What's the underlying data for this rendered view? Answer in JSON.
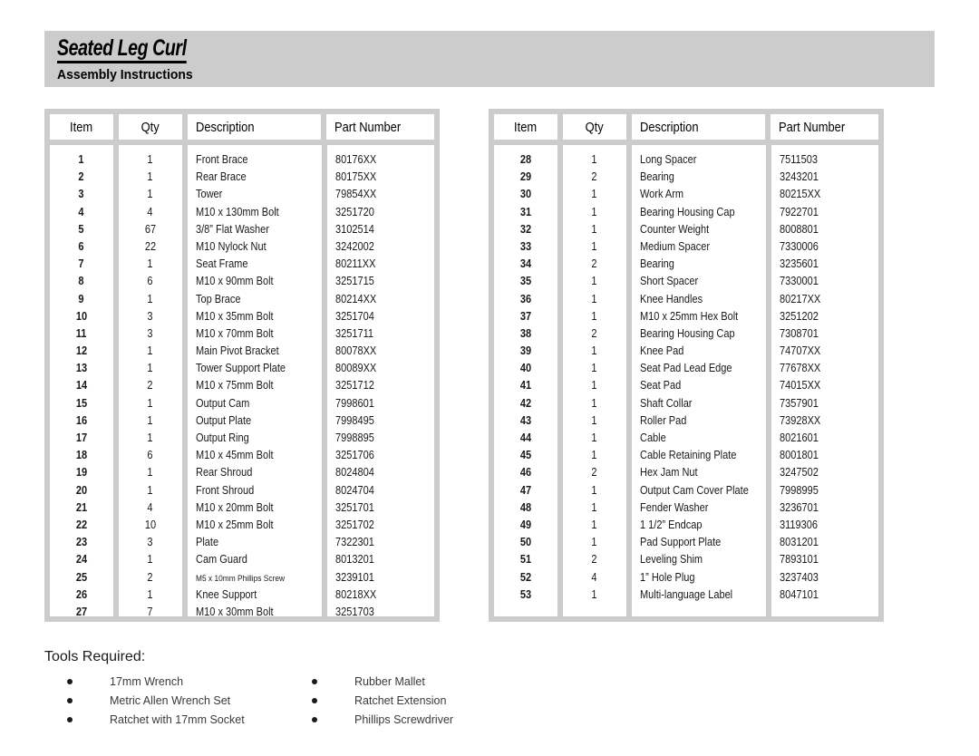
{
  "header": {
    "title": "Seated Leg Curl",
    "subtitle": "Assembly Instructions",
    "background_color": "#cccccc"
  },
  "tables": {
    "columns": [
      "Item",
      "Qty",
      "Description",
      "Part Number"
    ],
    "left": {
      "headers": [
        "Item",
        "Qty",
        "Description",
        "Part Number"
      ],
      "rows": [
        {
          "item": "1",
          "qty": "1",
          "description": "Front Brace",
          "part": "80176XX"
        },
        {
          "item": "2",
          "qty": "1",
          "description": "Rear Brace",
          "part": "80175XX"
        },
        {
          "item": "3",
          "qty": "1",
          "description": "Tower",
          "part": "79854XX"
        },
        {
          "item": "4",
          "qty": "4",
          "description": "M10 x 130mm Bolt",
          "part": "3251720"
        },
        {
          "item": "5",
          "qty": "67",
          "description": "3/8” Flat Washer",
          "part": "3102514"
        },
        {
          "item": "6",
          "qty": "22",
          "description": "M10 Nylock Nut",
          "part": "3242002"
        },
        {
          "item": "7",
          "qty": "1",
          "description": "Seat Frame",
          "part": "80211XX"
        },
        {
          "item": "8",
          "qty": "6",
          "description": "M10 x 90mm Bolt",
          "part": "3251715"
        },
        {
          "item": "9",
          "qty": "1",
          "description": "Top Brace",
          "part": "80214XX"
        },
        {
          "item": "10",
          "qty": "3",
          "description": "M10 x 35mm Bolt",
          "part": "3251704"
        },
        {
          "item": "11",
          "qty": "3",
          "description": "M10 x 70mm Bolt",
          "part": "3251711"
        },
        {
          "item": "12",
          "qty": "1",
          "description": "Main Pivot Bracket",
          "part": "80078XX"
        },
        {
          "item": "13",
          "qty": "1",
          "description": "Tower Support Plate",
          "part": "80089XX"
        },
        {
          "item": "14",
          "qty": "2",
          "description": "M10 x 75mm Bolt",
          "part": "3251712"
        },
        {
          "item": "15",
          "qty": "1",
          "description": "Output Cam",
          "part": "7998601"
        },
        {
          "item": "16",
          "qty": "1",
          "description": "Output Plate",
          "part": "7998495"
        },
        {
          "item": "17",
          "qty": "1",
          "description": "Output Ring",
          "part": "7998895"
        },
        {
          "item": "18",
          "qty": "6",
          "description": "M10 x 45mm Bolt",
          "part": "3251706"
        },
        {
          "item": "19",
          "qty": "1",
          "description": "Rear Shroud",
          "part": "8024804"
        },
        {
          "item": "20",
          "qty": "1",
          "description": "Front Shroud",
          "part": "8024704"
        },
        {
          "item": "21",
          "qty": "4",
          "description": "M10 x 20mm Bolt",
          "part": "3251701"
        },
        {
          "item": "22",
          "qty": "10",
          "description": "M10 x 25mm Bolt",
          "part": "3251702"
        },
        {
          "item": "23",
          "qty": "3",
          "description": "Plate",
          "part": "7322301"
        },
        {
          "item": "24",
          "qty": "1",
          "description": "Cam Guard",
          "part": "8013201"
        },
        {
          "item": "25",
          "qty": "2",
          "description": "M5 x 10mm Phillips Screw",
          "part": "3239101",
          "small": true
        },
        {
          "item": "26",
          "qty": "1",
          "description": "Knee Support",
          "part": "80218XX"
        },
        {
          "item": "27",
          "qty": "7",
          "description": "M10 x 30mm Bolt",
          "part": "3251703"
        }
      ]
    },
    "right": {
      "headers": [
        "Item",
        "Qty",
        "Description",
        "Part Number"
      ],
      "rows": [
        {
          "item": "28",
          "qty": "1",
          "description": "Long Spacer",
          "part": "7511503"
        },
        {
          "item": "29",
          "qty": "2",
          "description": "Bearing",
          "part": "3243201"
        },
        {
          "item": "30",
          "qty": "1",
          "description": "Work Arm",
          "part": "80215XX"
        },
        {
          "item": "31",
          "qty": "1",
          "description": "Bearing Housing Cap",
          "part": "7922701"
        },
        {
          "item": "32",
          "qty": "1",
          "description": "Counter Weight",
          "part": "8008801"
        },
        {
          "item": "33",
          "qty": "1",
          "description": "Medium Spacer",
          "part": "7330006"
        },
        {
          "item": "34",
          "qty": "2",
          "description": "Bearing",
          "part": "3235601"
        },
        {
          "item": "35",
          "qty": "1",
          "description": "Short Spacer",
          "part": "7330001"
        },
        {
          "item": "36",
          "qty": "1",
          "description": "Knee Handles",
          "part": "80217XX"
        },
        {
          "item": "37",
          "qty": "1",
          "description": "M10 x 25mm Hex Bolt",
          "part": "3251202"
        },
        {
          "item": "38",
          "qty": "2",
          "description": "Bearing Housing Cap",
          "part": "7308701"
        },
        {
          "item": "39",
          "qty": "1",
          "description": "Knee Pad",
          "part": "74707XX"
        },
        {
          "item": "40",
          "qty": "1",
          "description": "Seat Pad Lead Edge",
          "part": "77678XX"
        },
        {
          "item": "41",
          "qty": "1",
          "description": "Seat Pad",
          "part": "74015XX"
        },
        {
          "item": "42",
          "qty": "1",
          "description": "Shaft Collar",
          "part": "7357901"
        },
        {
          "item": "43",
          "qty": "1",
          "description": "Roller Pad",
          "part": "73928XX"
        },
        {
          "item": "44",
          "qty": "1",
          "description": "Cable",
          "part": "8021601"
        },
        {
          "item": "45",
          "qty": "1",
          "description": "Cable Retaining Plate",
          "part": "8001801"
        },
        {
          "item": "46",
          "qty": "2",
          "description": "Hex Jam Nut",
          "part": "3247502"
        },
        {
          "item": "47",
          "qty": "1",
          "description": "Output Cam Cover Plate",
          "part": "7998995"
        },
        {
          "item": "48",
          "qty": "1",
          "description": "Fender Washer",
          "part": "3236701"
        },
        {
          "item": "49",
          "qty": "1",
          "description": "1 1/2” Endcap",
          "part": "3119306"
        },
        {
          "item": "50",
          "qty": "1",
          "description": "Pad Support Plate",
          "part": "8031201"
        },
        {
          "item": "51",
          "qty": "2",
          "description": "Leveling Shim",
          "part": "7893101"
        },
        {
          "item": "52",
          "qty": "4",
          "description": "1” Hole Plug",
          "part": "3237403"
        },
        {
          "item": "53",
          "qty": "1",
          "description": "Multi-language Label",
          "part": "8047101"
        }
      ]
    }
  },
  "tools": {
    "title": "Tools Required:",
    "column_left": [
      "17mm Wrench",
      "Metric Allen Wrench Set",
      "Ratchet with 17mm Socket"
    ],
    "column_right": [
      "Rubber Mallet",
      "Ratchet Extension",
      "Phillips Screwdriver"
    ]
  }
}
